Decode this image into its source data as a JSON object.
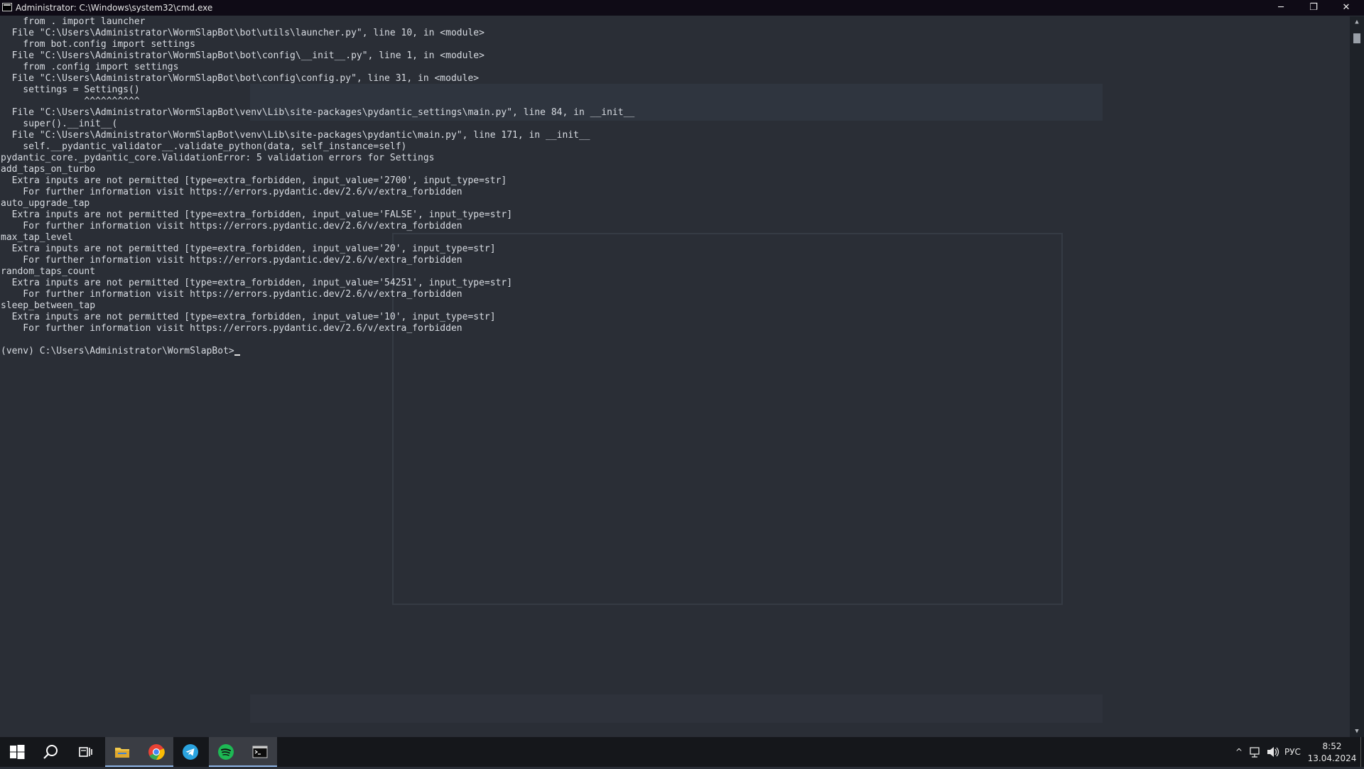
{
  "window": {
    "title": "Administrator: C:\\Windows\\system32\\cmd.exe",
    "controls": {
      "minimize": "─",
      "restore": "❐",
      "close": "✕"
    }
  },
  "console": {
    "lines": [
      "    from . import launcher",
      "  File \"C:\\Users\\Administrator\\WormSlapBot\\bot\\utils\\launcher.py\", line 10, in <module>",
      "    from bot.config import settings",
      "  File \"C:\\Users\\Administrator\\WormSlapBot\\bot\\config\\__init__.py\", line 1, in <module>",
      "    from .config import settings",
      "  File \"C:\\Users\\Administrator\\WormSlapBot\\bot\\config\\config.py\", line 31, in <module>",
      "    settings = Settings()",
      "               ^^^^^^^^^^",
      "  File \"C:\\Users\\Administrator\\WormSlapBot\\venv\\Lib\\site-packages\\pydantic_settings\\main.py\", line 84, in __init__",
      "    super().__init__(",
      "  File \"C:\\Users\\Administrator\\WormSlapBot\\venv\\Lib\\site-packages\\pydantic\\main.py\", line 171, in __init__",
      "    self.__pydantic_validator__.validate_python(data, self_instance=self)",
      "pydantic_core._pydantic_core.ValidationError: 5 validation errors for Settings",
      "add_taps_on_turbo",
      "  Extra inputs are not permitted [type=extra_forbidden, input_value='2700', input_type=str]",
      "    For further information visit https://errors.pydantic.dev/2.6/v/extra_forbidden",
      "auto_upgrade_tap",
      "  Extra inputs are not permitted [type=extra_forbidden, input_value='FALSE', input_type=str]",
      "    For further information visit https://errors.pydantic.dev/2.6/v/extra_forbidden",
      "max_tap_level",
      "  Extra inputs are not permitted [type=extra_forbidden, input_value='20', input_type=str]",
      "    For further information visit https://errors.pydantic.dev/2.6/v/extra_forbidden",
      "random_taps_count",
      "  Extra inputs are not permitted [type=extra_forbidden, input_value='54251', input_type=str]",
      "    For further information visit https://errors.pydantic.dev/2.6/v/extra_forbidden",
      "sleep_between_tap",
      "  Extra inputs are not permitted [type=extra_forbidden, input_value='10', input_type=str]",
      "    For further information visit https://errors.pydantic.dev/2.6/v/extra_forbidden",
      "",
      "(venv) C:\\Users\\Administrator\\WormSlapBot>"
    ]
  },
  "taskbar": {
    "items": [
      {
        "name": "start-button",
        "icon": "windows-logo-icon"
      },
      {
        "name": "search-button",
        "icon": "search-icon"
      },
      {
        "name": "task-view-button",
        "icon": "task-view-icon"
      },
      {
        "name": "file-explorer-button",
        "icon": "folder-icon"
      },
      {
        "name": "chrome-button",
        "icon": "chrome-icon"
      },
      {
        "name": "telegram-button",
        "icon": "telegram-icon"
      },
      {
        "name": "spotify-button",
        "icon": "spotify-icon"
      },
      {
        "name": "cmd-button",
        "icon": "terminal-icon"
      }
    ],
    "tray": {
      "chevron": "^",
      "language": "РУС",
      "time": "8:52",
      "date": "13.04.2024"
    },
    "colors": {
      "chrome": "#e94235",
      "telegram": "#2aa3df",
      "spotify": "#1db954",
      "folder": "#f2c94c",
      "active_underline": "#8fb6e8"
    }
  }
}
